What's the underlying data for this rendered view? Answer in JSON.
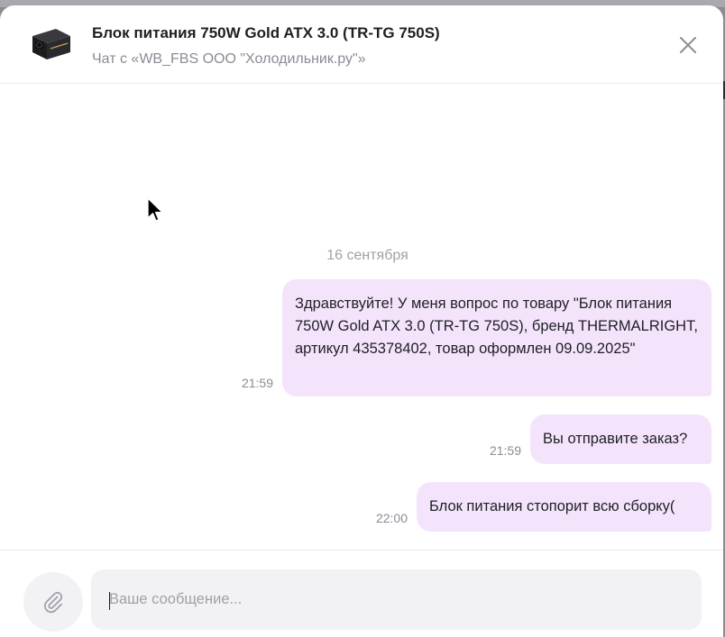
{
  "header": {
    "title": "Блок питания 750W Gold ATX 3.0 (TR-TG 750S)",
    "subtitle": "Чат с «WB_FBS ООО \"Холодильник.ру\"»",
    "thumbnail_icon": "power-supply-thumbnail",
    "close_icon": "close-icon"
  },
  "chat": {
    "date_separator": "16 сентября",
    "messages": [
      {
        "text": "Здравствуйте! У меня вопрос по товару \"Блок питания 750W Gold ATX 3.0 (TR-TG 750S), бренд THERMALRIGHT, артикул 435378402, товар оформлен 09.09.2025\"",
        "time": "21:59"
      },
      {
        "text": "Вы отправите заказ?",
        "time": "21:59"
      },
      {
        "text": "Блок питания стопорит всю сборку(",
        "time": "22:00"
      }
    ]
  },
  "composer": {
    "placeholder": "Ваше сообщение...",
    "value": "",
    "attach_icon": "paperclip-icon"
  },
  "colors": {
    "bubble_background": "#f3e4fc",
    "muted_text": "#8b8b95",
    "input_background": "#f2f2f5"
  }
}
